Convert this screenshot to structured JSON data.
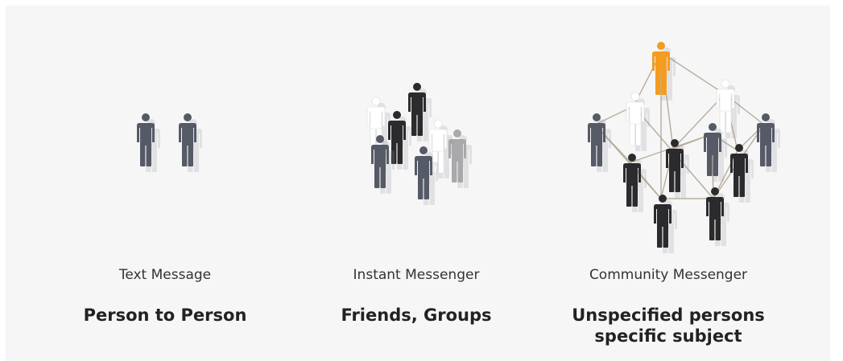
{
  "columns": [
    {
      "caption": "Text Message",
      "headline": [
        "Person to Person"
      ]
    },
    {
      "caption": "Instant Messenger",
      "headline": [
        "Friends, Groups"
      ]
    },
    {
      "caption": "Community Messenger",
      "headline": [
        "Unspecified persons",
        "specific subject"
      ]
    }
  ],
  "colors": {
    "background": "#f6f6f7",
    "figure_dark": "#2b2b2d",
    "figure_slate": "#555a66",
    "figure_white": "#ffffff",
    "figure_gray": "#a9a9ab",
    "figure_highlight": "#f39c1f",
    "network_line": "#b9ad9b"
  }
}
